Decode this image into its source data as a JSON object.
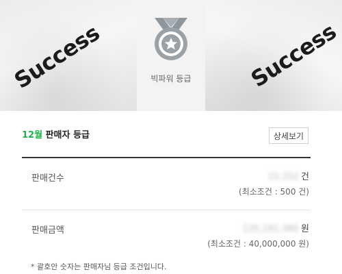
{
  "banner": {
    "left_photo_text": "Success",
    "right_photo_text": "Success",
    "badge_label": "빅파워 등급"
  },
  "grade": {
    "month": "12월",
    "title": "판매자 등급",
    "detail_button": "상세보기"
  },
  "metrics": [
    {
      "label": "판매건수",
      "value": "15,152",
      "unit": "건",
      "condition": "(최소조건 : 500 건)"
    },
    {
      "label": "판매금액",
      "value": "135,191,380",
      "unit": "원",
      "condition": "(최소조건 : 40,000,000 원)"
    }
  ],
  "footnote": "* 괄호안 숫자는 판매자님 등급 조건입니다.",
  "colors": {
    "accent_green": "#1db24b",
    "medal_gray": "#9aa2a8"
  },
  "icons": {
    "medal": "medal-star-icon"
  }
}
